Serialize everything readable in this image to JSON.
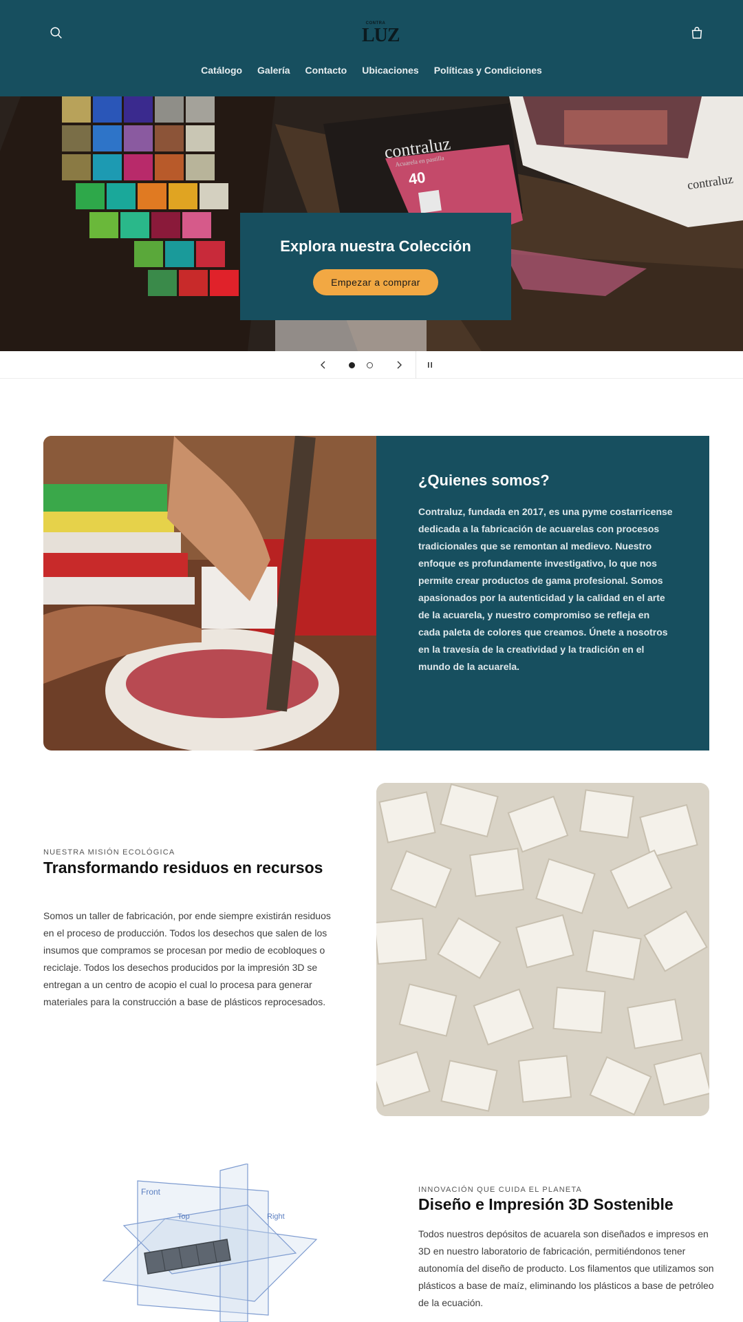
{
  "header": {
    "logo_small": "CONTRA",
    "logo_big": "LUZ",
    "nav": [
      "Catálogo",
      "Galería",
      "Contacto",
      "Ubicaciones",
      "Políticas y Condiciones"
    ],
    "search_icon": "search-icon",
    "cart_icon": "cart-icon"
  },
  "hero": {
    "title": "Explora nuestra Colección",
    "button": "Empezar a comprar",
    "photo_text_1": "contraluz",
    "photo_text_2": "Acuarela en pastilla",
    "photo_text_3": "40",
    "photo_text_4": "contraluz"
  },
  "slider": {
    "prev_icon": "chevron-left-icon",
    "next_icon": "chevron-right-icon",
    "pause_icon": "pause-icon",
    "slides": 2,
    "active": 1
  },
  "about": {
    "title": "¿Quienes somos?",
    "text": "Contraluz, fundada en 2017, es una pyme costarricense dedicada a la fabricación de acuarelas con procesos tradicionales que se remontan al medievo. Nuestro enfoque es profundamente investigativo, lo que nos permite crear productos de gama profesional. Somos apasionados por la autenticidad y la calidad en el arte de la acuarela, y nuestro compromiso se refleja en cada paleta de colores que creamos. Únete a nosotros en la travesía de la creatividad y la tradición en el mundo de la acuarela."
  },
  "eco": {
    "subtitle": "NUESTRA MISIÓN ECOLÓGICA",
    "title": "Transformando residuos en recursos",
    "text": "Somos un taller de fabricación, por ende siempre existirán residuos en el proceso de producción. Todos los desechos que salen de los insumos que compramos se procesan por medio de ecobloques o reciclaje. Todos los desechos producidos por la impresión 3D se entregan a un centro de acopio el cual lo procesa para generar materiales para la construcción a base de plásticos reprocesados."
  },
  "d3": {
    "subtitle": "INNOVACIÓN QUE CUIDA EL PLANETA",
    "title": "Diseño e Impresión 3D Sostenible",
    "text": "Todos nuestros depósitos de acuarela son diseñados e impresos en 3D en nuestro laboratorio de fabricación, permitiéndonos tener autonomía del diseño de producto. Los filamentos que utilizamos son plásticos a base de maíz, eliminando los plásticos a base de petróleo de la ecuación.",
    "label_front": "Front",
    "label_top": "Top",
    "label_right": "Right"
  },
  "colors": {
    "brand": "#174f5f",
    "accent": "#f2a843"
  }
}
